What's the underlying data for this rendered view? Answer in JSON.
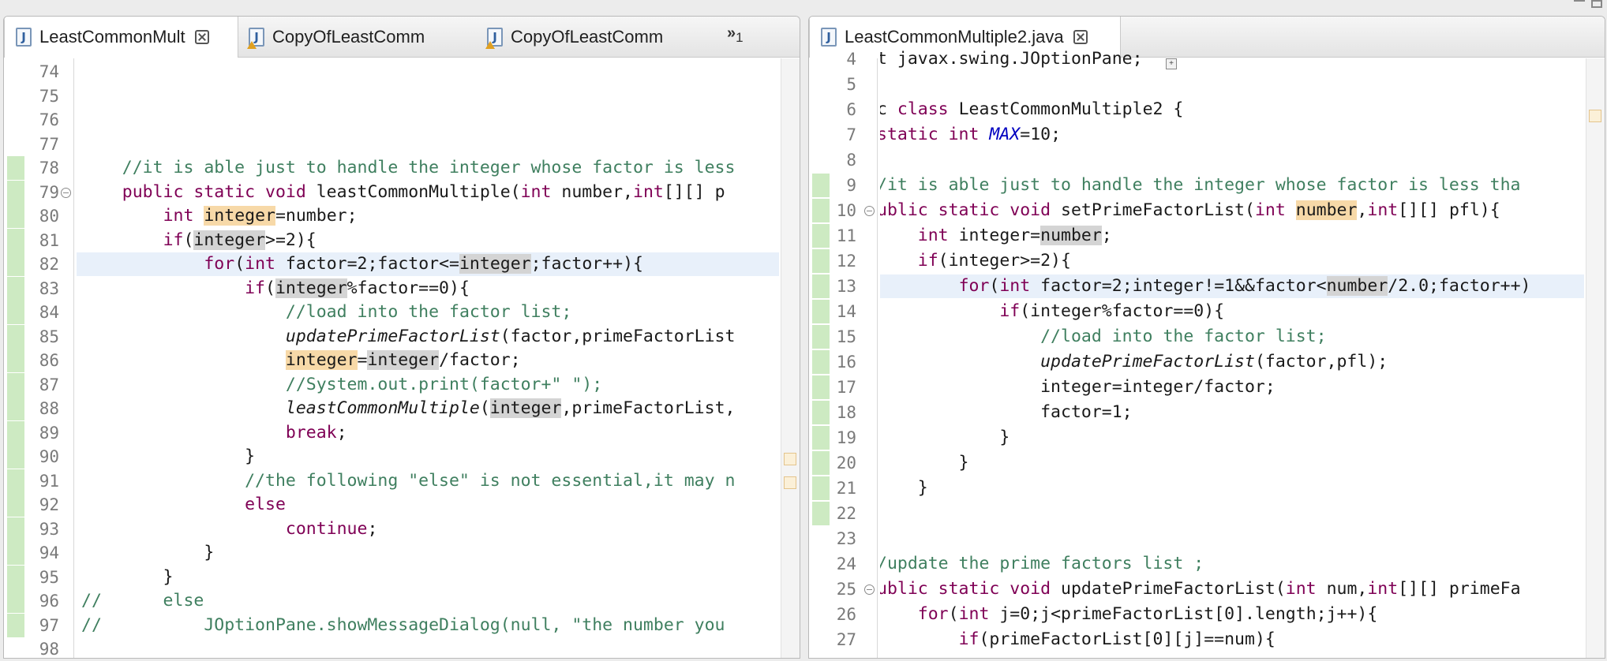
{
  "left": {
    "tabs": [
      {
        "label": "LeastCommonMult",
        "active": true,
        "warning": false,
        "closable": true
      },
      {
        "label": "CopyOfLeastComm",
        "active": false,
        "warning": true,
        "closable": false
      },
      {
        "label": "CopyOfLeastComm",
        "active": false,
        "warning": true,
        "closable": false
      }
    ],
    "overflow_label": "»",
    "overflow_count": "1",
    "lines": [
      {
        "n": "74",
        "changed": false,
        "fold": false,
        "current": false,
        "tokens": []
      },
      {
        "n": "75",
        "changed": false,
        "fold": false,
        "current": false,
        "tokens": []
      },
      {
        "n": "76",
        "changed": false,
        "fold": false,
        "current": false,
        "tokens": []
      },
      {
        "n": "77",
        "changed": false,
        "fold": false,
        "current": false,
        "tokens": []
      },
      {
        "n": "78",
        "changed": true,
        "fold": false,
        "current": false,
        "tokens": [
          {
            "t": "    "
          },
          {
            "t": "//it is able just to handle the integer whose factor is less",
            "c": "cm"
          }
        ]
      },
      {
        "n": "79",
        "changed": true,
        "fold": true,
        "current": false,
        "tokens": [
          {
            "t": "    "
          },
          {
            "t": "public static void",
            "c": "kw"
          },
          {
            "t": " leastCommonMultiple("
          },
          {
            "t": "int",
            "c": "kw"
          },
          {
            "t": " number,"
          },
          {
            "t": "int",
            "c": "kw"
          },
          {
            "t": "[][] p"
          }
        ]
      },
      {
        "n": "80",
        "changed": true,
        "fold": false,
        "current": false,
        "tokens": [
          {
            "t": "        "
          },
          {
            "t": "int",
            "c": "kw"
          },
          {
            "t": " "
          },
          {
            "t": "integer",
            "c": "sel"
          },
          {
            "t": "=number;"
          }
        ]
      },
      {
        "n": "81",
        "changed": true,
        "fold": false,
        "current": false,
        "tokens": [
          {
            "t": "        "
          },
          {
            "t": "if",
            "c": "kw"
          },
          {
            "t": "("
          },
          {
            "t": "integer",
            "c": "occ"
          },
          {
            "t": ">=2){"
          }
        ]
      },
      {
        "n": "82",
        "changed": true,
        "fold": false,
        "current": true,
        "tokens": [
          {
            "t": "            "
          },
          {
            "t": "for",
            "c": "kw"
          },
          {
            "t": "("
          },
          {
            "t": "int",
            "c": "kw"
          },
          {
            "t": " factor=2;factor<="
          },
          {
            "t": "integer",
            "c": "occ"
          },
          {
            "t": ";factor++){"
          }
        ]
      },
      {
        "n": "83",
        "changed": true,
        "fold": false,
        "current": false,
        "tokens": [
          {
            "t": "                "
          },
          {
            "t": "if",
            "c": "kw"
          },
          {
            "t": "("
          },
          {
            "t": "integer",
            "c": "occ"
          },
          {
            "t": "%factor==0){"
          }
        ]
      },
      {
        "n": "84",
        "changed": true,
        "fold": false,
        "current": false,
        "tokens": [
          {
            "t": "                    "
          },
          {
            "t": "//load into the factor list;",
            "c": "cm"
          }
        ]
      },
      {
        "n": "85",
        "changed": true,
        "fold": false,
        "current": false,
        "tokens": [
          {
            "t": "                    "
          },
          {
            "t": "updatePrimeFactorList",
            "c": "it"
          },
          {
            "t": "(factor,primeFactorList"
          }
        ]
      },
      {
        "n": "86",
        "changed": true,
        "fold": false,
        "current": false,
        "tokens": [
          {
            "t": "                    "
          },
          {
            "t": "integer",
            "c": "sel"
          },
          {
            "t": "="
          },
          {
            "t": "integer",
            "c": "occ"
          },
          {
            "t": "/factor;"
          }
        ]
      },
      {
        "n": "87",
        "changed": true,
        "fold": false,
        "current": false,
        "tokens": [
          {
            "t": "                    "
          },
          {
            "t": "//System.out.print(factor+\" \");",
            "c": "cm"
          }
        ]
      },
      {
        "n": "88",
        "changed": true,
        "fold": false,
        "current": false,
        "tokens": [
          {
            "t": "                    "
          },
          {
            "t": "leastCommonMultiple",
            "c": "it"
          },
          {
            "t": "("
          },
          {
            "t": "integer",
            "c": "occ"
          },
          {
            "t": ",primeFactorList,"
          }
        ]
      },
      {
        "n": "89",
        "changed": true,
        "fold": false,
        "current": false,
        "tokens": [
          {
            "t": "                    "
          },
          {
            "t": "break",
            "c": "kw"
          },
          {
            "t": ";"
          }
        ]
      },
      {
        "n": "90",
        "changed": true,
        "fold": false,
        "current": false,
        "tokens": [
          {
            "t": "                }"
          }
        ]
      },
      {
        "n": "91",
        "changed": true,
        "fold": false,
        "current": false,
        "tokens": [
          {
            "t": "                "
          },
          {
            "t": "//the following \"else\" is not essential,it may n",
            "c": "cm"
          }
        ]
      },
      {
        "n": "92",
        "changed": true,
        "fold": false,
        "current": false,
        "tokens": [
          {
            "t": "                "
          },
          {
            "t": "else",
            "c": "kw"
          }
        ]
      },
      {
        "n": "93",
        "changed": true,
        "fold": false,
        "current": false,
        "tokens": [
          {
            "t": "                    "
          },
          {
            "t": "continue",
            "c": "kw"
          },
          {
            "t": ";"
          }
        ]
      },
      {
        "n": "94",
        "changed": true,
        "fold": false,
        "current": false,
        "tokens": [
          {
            "t": "            }"
          }
        ]
      },
      {
        "n": "95",
        "changed": true,
        "fold": false,
        "current": false,
        "tokens": [
          {
            "t": "        }"
          }
        ]
      },
      {
        "n": "96",
        "changed": true,
        "fold": false,
        "current": false,
        "tokens": [
          {
            "t": "//      else",
            "c": "cm"
          }
        ]
      },
      {
        "n": "97",
        "changed": true,
        "fold": false,
        "current": false,
        "tokens": [
          {
            "t": "//          JOptionPane.showMessageDialog(null, \"the number you",
            "c": "cm"
          }
        ]
      },
      {
        "n": "98",
        "changed": false,
        "fold": false,
        "current": false,
        "tokens": []
      }
    ]
  },
  "right": {
    "tabs": [
      {
        "label": "LeastCommonMultiple2.java",
        "active": true,
        "warning": false,
        "closable": true
      }
    ],
    "lines": [
      {
        "n": "4",
        "changed": false,
        "fold": false,
        "current": false,
        "tokens": [
          {
            "t": "t javax.swing.JOptionPane;"
          }
        ]
      },
      {
        "n": "5",
        "changed": false,
        "fold": false,
        "current": false,
        "tokens": []
      },
      {
        "n": "6",
        "changed": false,
        "fold": false,
        "current": false,
        "tokens": [
          {
            "t": "c "
          },
          {
            "t": "class",
            "c": "kw"
          },
          {
            "t": " LeastCommonMultiple2 {"
          }
        ]
      },
      {
        "n": "7",
        "changed": false,
        "fold": false,
        "current": false,
        "tokens": [
          {
            "t": "static int",
            "c": "kw"
          },
          {
            "t": " "
          },
          {
            "t": "MAX",
            "c": "fld"
          },
          {
            "t": "=10;"
          }
        ]
      },
      {
        "n": "8",
        "changed": false,
        "fold": false,
        "current": false,
        "tokens": []
      },
      {
        "n": "9",
        "changed": true,
        "fold": false,
        "current": false,
        "tokens": [
          {
            "t": "/it is able just to handle the integer whose factor is less tha",
            "c": "cm"
          }
        ]
      },
      {
        "n": "10",
        "changed": true,
        "fold": true,
        "current": false,
        "tokens": [
          {
            "t": "ublic static void",
            "c": "kw"
          },
          {
            "t": " setPrimeFactorList("
          },
          {
            "t": "int",
            "c": "kw"
          },
          {
            "t": " "
          },
          {
            "t": "number",
            "c": "sel"
          },
          {
            "t": ","
          },
          {
            "t": "int",
            "c": "kw"
          },
          {
            "t": "[][] pfl){"
          }
        ]
      },
      {
        "n": "11",
        "changed": true,
        "fold": false,
        "current": false,
        "tokens": [
          {
            "t": "    "
          },
          {
            "t": "int",
            "c": "kw"
          },
          {
            "t": " integer="
          },
          {
            "t": "number",
            "c": "occ"
          },
          {
            "t": ";"
          }
        ]
      },
      {
        "n": "12",
        "changed": true,
        "fold": false,
        "current": false,
        "tokens": [
          {
            "t": "    "
          },
          {
            "t": "if",
            "c": "kw"
          },
          {
            "t": "(integer>=2){"
          }
        ]
      },
      {
        "n": "13",
        "changed": true,
        "fold": false,
        "current": true,
        "tokens": [
          {
            "t": "        "
          },
          {
            "t": "for",
            "c": "kw"
          },
          {
            "t": "("
          },
          {
            "t": "int",
            "c": "kw"
          },
          {
            "t": " factor=2;integer!=1&&factor<"
          },
          {
            "t": "number",
            "c": "occ"
          },
          {
            "t": "/2.0;factor++)"
          }
        ]
      },
      {
        "n": "14",
        "changed": true,
        "fold": false,
        "current": false,
        "tokens": [
          {
            "t": "            "
          },
          {
            "t": "if",
            "c": "kw"
          },
          {
            "t": "(integer%factor==0){"
          }
        ]
      },
      {
        "n": "15",
        "changed": true,
        "fold": false,
        "current": false,
        "tokens": [
          {
            "t": "                "
          },
          {
            "t": "//load into the factor list;",
            "c": "cm"
          }
        ]
      },
      {
        "n": "16",
        "changed": true,
        "fold": false,
        "current": false,
        "tokens": [
          {
            "t": "                "
          },
          {
            "t": "updatePrimeFactorList",
            "c": "it"
          },
          {
            "t": "(factor,pfl);"
          }
        ]
      },
      {
        "n": "17",
        "changed": true,
        "fold": false,
        "current": false,
        "tokens": [
          {
            "t": "                integer=integer/factor;"
          }
        ]
      },
      {
        "n": "18",
        "changed": true,
        "fold": false,
        "current": false,
        "tokens": [
          {
            "t": "                factor=1;"
          }
        ]
      },
      {
        "n": "19",
        "changed": true,
        "fold": false,
        "current": false,
        "tokens": [
          {
            "t": "            }"
          }
        ]
      },
      {
        "n": "20",
        "changed": true,
        "fold": false,
        "current": false,
        "tokens": [
          {
            "t": "        }"
          }
        ]
      },
      {
        "n": "21",
        "changed": true,
        "fold": false,
        "current": false,
        "tokens": [
          {
            "t": "    }"
          }
        ]
      },
      {
        "n": "22",
        "changed": true,
        "fold": false,
        "current": false,
        "tokens": []
      },
      {
        "n": "23",
        "changed": false,
        "fold": false,
        "current": false,
        "tokens": []
      },
      {
        "n": "24",
        "changed": false,
        "fold": false,
        "current": false,
        "tokens": [
          {
            "t": "/update the prime factors list ;",
            "c": "cm"
          }
        ]
      },
      {
        "n": "25",
        "changed": false,
        "fold": true,
        "current": false,
        "tokens": [
          {
            "t": "ublic static void",
            "c": "kw"
          },
          {
            "t": " updatePrimeFactorList("
          },
          {
            "t": "int",
            "c": "kw"
          },
          {
            "t": " num,"
          },
          {
            "t": "int",
            "c": "kw"
          },
          {
            "t": "[][] primeFa"
          }
        ]
      },
      {
        "n": "26",
        "changed": false,
        "fold": false,
        "current": false,
        "tokens": [
          {
            "t": "    "
          },
          {
            "t": "for",
            "c": "kw"
          },
          {
            "t": "("
          },
          {
            "t": "int",
            "c": "kw"
          },
          {
            "t": " j=0;j<primeFactorList[0].length;j++){"
          }
        ]
      },
      {
        "n": "27",
        "changed": false,
        "fold": false,
        "current": false,
        "tokens": [
          {
            "t": "        "
          },
          {
            "t": "if",
            "c": "kw"
          },
          {
            "t": "(primeFactorList[0][j]==num){"
          }
        ]
      }
    ]
  }
}
